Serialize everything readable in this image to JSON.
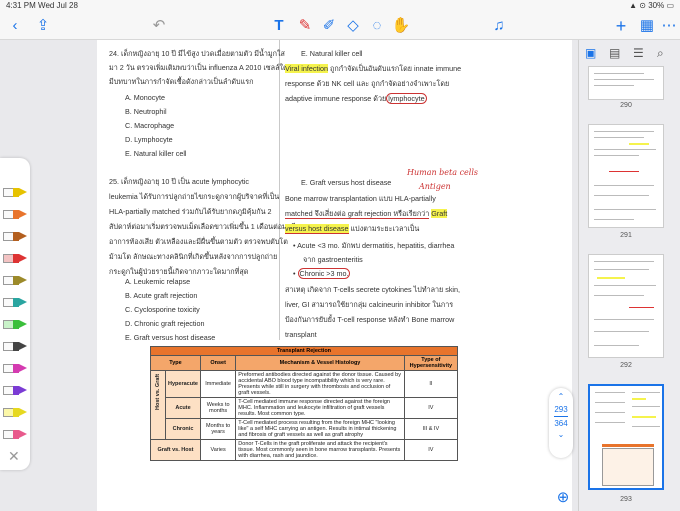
{
  "status": {
    "time": "4:31 PM",
    "date": "Wed Jul 28",
    "wifi": "wifi-icon",
    "battery": "30%"
  },
  "toolbar": {
    "tools": [
      "back-icon",
      "share-icon",
      "undo-icon",
      "text-tool-icon",
      "pen-icon",
      "highlighter-icon",
      "eraser-icon",
      "lasso-icon",
      "hand-icon",
      "mic-icon",
      "add-icon",
      "more-icon"
    ]
  },
  "left_col": {
    "q24": "24. เด็กหญิงอายุ 10 ปี มีไข้สูง ปวดเมื่อยตามตัว มีน้ำมูกใส",
    "q24_l2": "มา 2 วัน ตรวจเพิ่มเติมพบว่าเป็น influenza A 2010 เซลล์ใด",
    "q24_l3": "มีบทบาทในการกำจัดเชื้อดังกล่าวเป็นลำดับแรก",
    "q24_opts": [
      "A.    Monocyte",
      "B.    Neutrophil",
      "C.    Macrophage",
      "D.    Lymphocyte",
      "E.    Natural killer cell"
    ],
    "q25": "25. เด็กหญิงอายุ 10 ปี เป็น acute lymphocytic",
    "q25_l2": "leukemia ได้รับการปลูกถ่ายไขกระดูกจากผู้บริจาคที่เป็น",
    "q25_l3": "HLA-partially matched ร่วมกับได้รับยากดภูมิคุ้มกัน 2",
    "q25_l4": "สัปดาห์ต่อมาเริ่มตรวจพบเม็ดเลือดขาวเพิ่มขึ้น 1 เดือนต่อมามี",
    "q25_l5": "อาการท้องเสีย ตัวเหลืองและมีผื่นขึ้นตามตัว ตรวจพบตับโต",
    "q25_l6": "ม้ามโต ลักษณะทางคลินิกที่เกิดขึ้นหลังจากการปลูกถ่าย",
    "q25_l7": "กระดูกในผู้ป่วยรายนี้เกิดจากภาวะใดมากที่สุด",
    "q25_opts": [
      "A.    Leukemic relapse",
      "B.    Acute graft rejection",
      "C.    Cyclosporine toxicity",
      "D.    Chronic graft rejection",
      "E.    Graft versus host disease"
    ]
  },
  "right_col": {
    "e1": "E.    Natural killer cell",
    "viral": "Viral infection",
    "viral_rest": " ถูกกำจัดเป็นอันดับแรกโดย innate immune",
    "l2": "response ด้วย NK cell และ ถูกกำจัดอย่างจำเพาะโดย",
    "l3": "adaptive immune response ด้วย",
    "lympho": "lymphocyte",
    "e2": "E.    Graft versus host disease",
    "bm1": "Bone marrow transplantation แบบ HLA-partially",
    "bm2": "matched จึงเสี่ยงต่อ graft rejection หรือเรียกว่า",
    "gvhd_hl": "Graft",
    "gvhd_hl2": "versus host disease",
    "bm3": " แบ่งตามระยะเวลาเป็น",
    "acute": "Acute <3 mo. มักพบ dermatitis, hepatitis, diarrhea",
    "acute2": "จาก gastroenteritis",
    "chronic": "Chronic >3 mo.",
    "p1": "สาเหตุ เกิดจาก T-cells secrete cytokines ไปทำลาย skin,",
    "p2": "liver, GI สามารถใช้ยากลุ่ม calcineurin inhibitor ในการ",
    "p3": "ป้องกันการยับยั้ง T-cell response หลังทำ Bone marrow",
    "p4": "transplant",
    "note1": "Human beta cells",
    "note2": "Antigen"
  },
  "table": {
    "title": "Transplant Rejection",
    "headers": [
      "Type",
      "Onset",
      "Mechanism & Vessel Histology",
      "Type of Hypersensitivity"
    ],
    "group": "Host vs. Graft",
    "rows": [
      {
        "type": "Hyperacute",
        "onset": "Immediate",
        "mech": "Preformed antibodies directed against the donor tissue. Caused by accidental ABO blood type incompatibility which is very rare. Presents while still in surgery with thrombosis and occlusion of graft vessels.",
        "hyp": "II"
      },
      {
        "type": "Acute",
        "onset": "Weeks to months",
        "mech": "T-Cell mediated immune response directed against the foreign MHC. Inflammation and leukocyte infiltration of graft vessels results. Most common type.",
        "hyp": "IV"
      },
      {
        "type": "Chronic",
        "onset": "Months to years",
        "mech": "T-Cell mediated process resulting from the foreign MHC \"looking like\" a self MHC carrying an antigen. Results in intimal thickening and fibrosis of graft vessels as well as graft atrophy",
        "hyp": "III & IV"
      },
      {
        "type": "Graft vs. Host",
        "onset": "Varies",
        "mech": "Donor T-Cells in the graft proliferate and attack the recipient's tissue. Most commonly seen in bone marrow transplants. Presents with diarrhea, rash and jaundice.",
        "hyp": "IV"
      }
    ]
  },
  "sidebar": {
    "icons": [
      "pages-icon",
      "bookmark-icon",
      "outline-icon",
      "search-icon"
    ],
    "pages": [
      "290",
      "291",
      "292",
      "293"
    ]
  },
  "page_indicator": {
    "current": "293",
    "total": "364"
  },
  "colors": {
    "accent": "#1a73e8",
    "ink": "#cc3333",
    "highlight": "#f5f34d",
    "table_header": "#e8742c"
  }
}
